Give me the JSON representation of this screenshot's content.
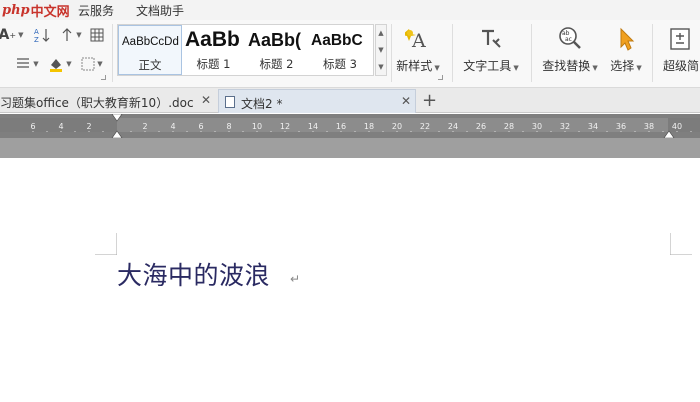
{
  "menubar": {
    "logo_php": "php",
    "logo_cn": "中文网",
    "items": [
      "云服务",
      "文档助手"
    ]
  },
  "ribbon": {
    "style_gallery": [
      {
        "sample": "AaBbCcDd",
        "name": "正文"
      },
      {
        "sample": "AaBb",
        "name": "标题 1"
      },
      {
        "sample": "AaBb(",
        "name": "标题 2"
      },
      {
        "sample": "AaBbC",
        "name": "标题 3"
      }
    ],
    "new_style_label": "新样式",
    "text_tools_label": "文字工具",
    "find_replace_label": "查找替换",
    "select_label": "选择",
    "super_label": "超级简"
  },
  "tabs": [
    {
      "title": "习题集office（职大教育新10）.doc",
      "active": false
    },
    {
      "title": "文档2 *",
      "active": true
    }
  ],
  "ruler": {
    "labels": [
      "6",
      "4",
      "2",
      "2",
      "4",
      "6",
      "8",
      "10",
      "12",
      "14",
      "16",
      "18",
      "20",
      "22",
      "24",
      "26",
      "28",
      "30",
      "32",
      "34",
      "36",
      "38",
      "40"
    ]
  },
  "document": {
    "text": "大海中的波浪"
  },
  "colors": {
    "accent_blue": "#2a63b8",
    "logo_red": "#c8332b",
    "ruler_gray": "#7f7f7f",
    "doc_text": "#2a2a62"
  },
  "icons": [
    "font-size-icon",
    "sort-icon",
    "numbering-icon",
    "table-borders-icon",
    "line-spacing-icon",
    "shading-icon",
    "borders-icon",
    "new-style-icon",
    "text-tools-icon",
    "find-replace-icon",
    "select-arrow-icon",
    "super-icon"
  ]
}
